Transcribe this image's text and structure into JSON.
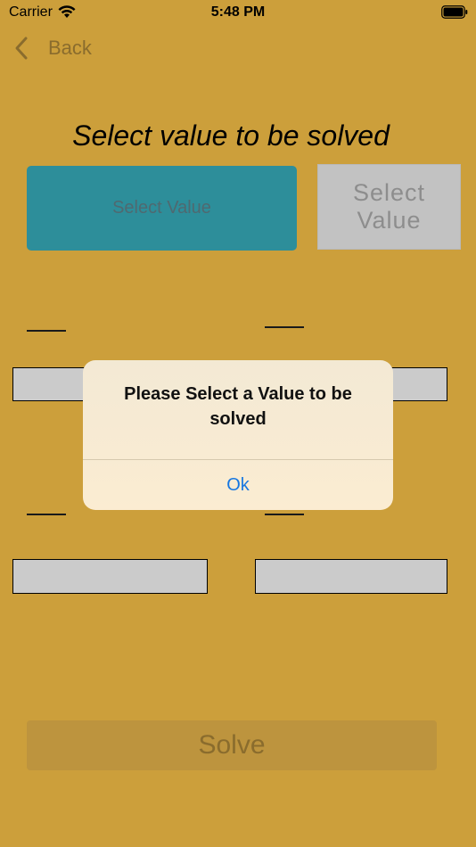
{
  "status_bar": {
    "carrier": "Carrier",
    "time": "5:48 PM"
  },
  "nav": {
    "back_label": "Back"
  },
  "page": {
    "title": "Select value to be solved",
    "select_primary_label": "Select Value",
    "select_secondary_line1": "Select",
    "select_secondary_line2": "Value"
  },
  "fields": {
    "top_left": "",
    "top_right": "",
    "bottom_left": "",
    "bottom_right": ""
  },
  "solve_label": "Solve",
  "alert": {
    "message": "Please Select a Value to be solved",
    "ok_label": "Ok"
  },
  "colors": {
    "background": "#cc9f3b",
    "primary_button": "#2d8e9a",
    "alert_action": "#1777e0"
  }
}
